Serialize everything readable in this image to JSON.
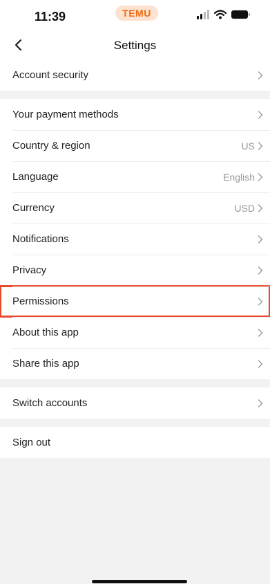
{
  "status_bar": {
    "time": "11:39",
    "app_pill": "TEMU",
    "accent_color": "#f26b0f"
  },
  "navbar": {
    "title": "Settings",
    "back_icon": "chevron-left-icon"
  },
  "groups": [
    [
      {
        "label": "Account security",
        "value": ""
      }
    ],
    [
      {
        "label": "Your payment methods",
        "value": ""
      },
      {
        "label": "Country & region",
        "value": "US"
      },
      {
        "label": "Language",
        "value": "English"
      },
      {
        "label": "Currency",
        "value": "USD"
      },
      {
        "label": "Notifications",
        "value": ""
      },
      {
        "label": "Privacy",
        "value": ""
      },
      {
        "label": "Permissions",
        "value": ""
      },
      {
        "label": "About this app",
        "value": ""
      },
      {
        "label": "Share this app",
        "value": ""
      }
    ],
    [
      {
        "label": "Switch accounts",
        "value": ""
      }
    ],
    [
      {
        "label": "Sign out",
        "value": ""
      }
    ]
  ],
  "highlight_color": "#e84a2e"
}
